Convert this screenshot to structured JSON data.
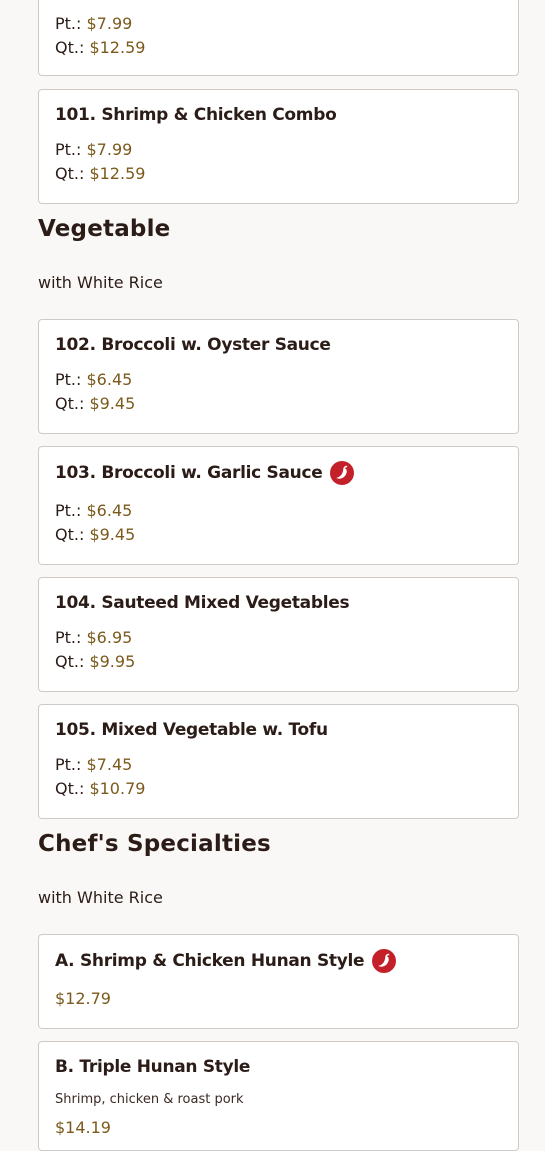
{
  "colors": {
    "price": "#7b5a1c",
    "spicy_badge": "#c3202a",
    "card_border": "#cfcac6"
  },
  "items": {
    "prev": {
      "pt_label": "Pt.:",
      "pt_price": "$7.99",
      "qt_label": "Qt.:",
      "qt_price": "$12.59"
    },
    "i101": {
      "title": "101. Shrimp & Chicken Combo",
      "pt_label": "Pt.:",
      "pt_price": "$7.99",
      "qt_label": "Qt.:",
      "qt_price": "$12.59"
    },
    "i102": {
      "title": "102. Broccoli w. Oyster Sauce",
      "pt_label": "Pt.:",
      "pt_price": "$6.45",
      "qt_label": "Qt.:",
      "qt_price": "$9.45"
    },
    "i103": {
      "title": "103. Broccoli w. Garlic Sauce",
      "spicy": true,
      "pt_label": "Pt.:",
      "pt_price": "$6.45",
      "qt_label": "Qt.:",
      "qt_price": "$9.45"
    },
    "i104": {
      "title": "104. Sauteed Mixed Vegetables",
      "pt_label": "Pt.:",
      "pt_price": "$6.95",
      "qt_label": "Qt.:",
      "qt_price": "$9.95"
    },
    "i105": {
      "title": "105. Mixed Vegetable w. Tofu",
      "pt_label": "Pt.:",
      "pt_price": "$7.45",
      "qt_label": "Qt.:",
      "qt_price": "$10.79"
    },
    "iA": {
      "title": "A. Shrimp & Chicken Hunan Style",
      "spicy": true,
      "price": "$12.79"
    },
    "iB": {
      "title": "B. Triple Hunan Style",
      "description": "Shrimp, chicken & roast pork",
      "price": "$14.19"
    }
  },
  "sections": {
    "vegetable": {
      "title": "Vegetable",
      "subtitle": "with White Rice"
    },
    "chef": {
      "title": "Chef's Specialties",
      "subtitle": "with White Rice"
    }
  },
  "icons": {
    "spicy": "chili-pepper-icon"
  }
}
